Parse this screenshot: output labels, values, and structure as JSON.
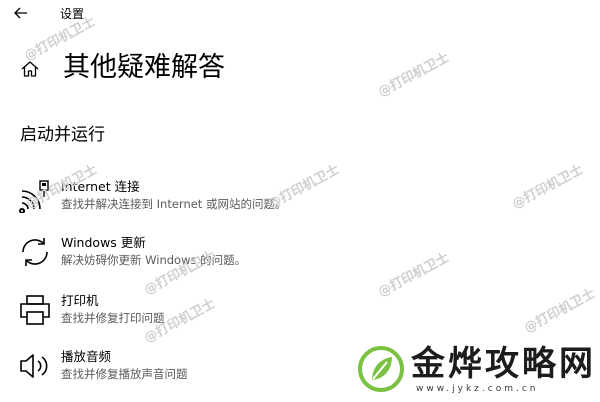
{
  "window": {
    "title": "设置"
  },
  "page": {
    "title": "其他疑难解答"
  },
  "section": {
    "title": "启动并运行"
  },
  "items": [
    {
      "name": "Internet 连接",
      "description": "查找并解决连接到 Internet 或网站的问题。",
      "icon": "wifi-ethernet-icon"
    },
    {
      "name": "Windows 更新",
      "description": "解决妨碍你更新 Windows 的问题。",
      "icon": "sync-icon"
    },
    {
      "name": "打印机",
      "description": "查找并修复打印问题",
      "icon": "printer-icon"
    },
    {
      "name": "播放音频",
      "description": "查找并修复播放声音问题",
      "icon": "speaker-icon"
    }
  ],
  "watermark": {
    "text": "@打印机卫士"
  },
  "logo": {
    "text": "金烨攻略网",
    "url": "www.jykz.com.cn"
  },
  "colors": {
    "description_text": "#5a5a5a",
    "logo_green": "#7cc242",
    "watermark": "#cfcfcf"
  }
}
